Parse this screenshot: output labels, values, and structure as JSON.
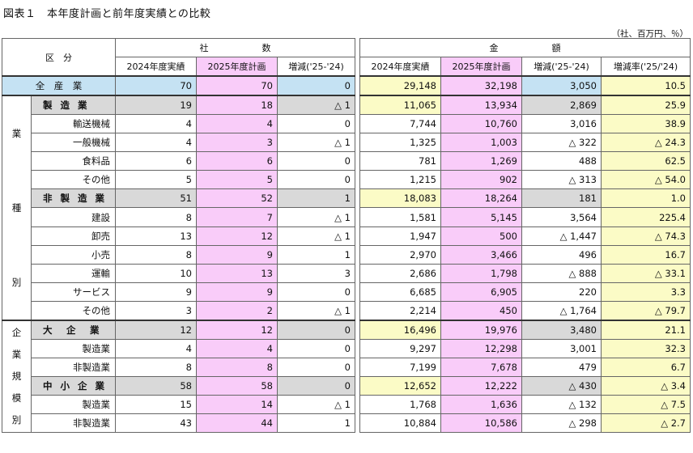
{
  "title": "図表１　本年度計画と前年度実績との比較",
  "unit": "（社、百万円、％）",
  "header": {
    "category": "区　分",
    "group_count": "社　　　　　　数",
    "group_amount": "金　　　　　　額",
    "count_cols": [
      "2024年度実績",
      "2025年度計画",
      "増減('25-'24)"
    ],
    "amount_cols": [
      "2024年度実績",
      "2025年度計画",
      "増減('25-'24)",
      "増減率('25/'24)"
    ]
  },
  "total": {
    "label": "全　産　業",
    "values": [
      "70",
      "70",
      "0",
      "29,148",
      "32,198",
      "3,050",
      "10.5"
    ]
  },
  "industry_section_label": [
    "業",
    "種",
    "別"
  ],
  "scale_section_label": [
    "企",
    "業",
    "規",
    "模",
    "別"
  ],
  "industry_rows": [
    {
      "label": "製 造 業",
      "bold": true,
      "values": [
        "19",
        "18",
        "△ 1",
        "11,065",
        "13,934",
        "2,869",
        "25.9"
      ]
    },
    {
      "label": "輸送機械",
      "bold": false,
      "values": [
        "4",
        "4",
        "0",
        "7,744",
        "10,760",
        "3,016",
        "38.9"
      ]
    },
    {
      "label": "一般機械",
      "bold": false,
      "values": [
        "4",
        "3",
        "△ 1",
        "1,325",
        "1,003",
        "△ 322",
        "△ 24.3"
      ]
    },
    {
      "label": "食料品",
      "bold": false,
      "values": [
        "6",
        "6",
        "0",
        "781",
        "1,269",
        "488",
        "62.5"
      ]
    },
    {
      "label": "その他",
      "bold": false,
      "values": [
        "5",
        "5",
        "0",
        "1,215",
        "902",
        "△ 313",
        "△ 54.0"
      ]
    },
    {
      "label": "非 製 造 業",
      "bold": true,
      "values": [
        "51",
        "52",
        "1",
        "18,083",
        "18,264",
        "181",
        "1.0"
      ]
    },
    {
      "label": "建設",
      "bold": false,
      "values": [
        "8",
        "7",
        "△ 1",
        "1,581",
        "5,145",
        "3,564",
        "225.4"
      ]
    },
    {
      "label": "卸売",
      "bold": false,
      "values": [
        "13",
        "12",
        "△ 1",
        "1,947",
        "500",
        "△ 1,447",
        "△ 74.3"
      ]
    },
    {
      "label": "小売",
      "bold": false,
      "values": [
        "8",
        "9",
        "1",
        "2,970",
        "3,466",
        "496",
        "16.7"
      ]
    },
    {
      "label": "運輸",
      "bold": false,
      "values": [
        "10",
        "13",
        "3",
        "2,686",
        "1,798",
        "△ 888",
        "△ 33.1"
      ]
    },
    {
      "label": "サービス",
      "bold": false,
      "values": [
        "9",
        "9",
        "0",
        "6,685",
        "6,905",
        "220",
        "3.3"
      ]
    },
    {
      "label": "その他",
      "bold": false,
      "values": [
        "3",
        "2",
        "△ 1",
        "2,214",
        "450",
        "△ 1,764",
        "△ 79.7"
      ]
    }
  ],
  "scale_rows": [
    {
      "label": "大　企　業",
      "bold": true,
      "values": [
        "12",
        "12",
        "0",
        "16,496",
        "19,976",
        "3,480",
        "21.1"
      ]
    },
    {
      "label": "製造業",
      "bold": false,
      "values": [
        "4",
        "4",
        "0",
        "9,297",
        "12,298",
        "3,001",
        "32.3"
      ]
    },
    {
      "label": "非製造業",
      "bold": false,
      "values": [
        "8",
        "8",
        "0",
        "7,199",
        "7,678",
        "479",
        "6.7"
      ]
    },
    {
      "label": "中 小 企 業",
      "bold": true,
      "values": [
        "58",
        "58",
        "0",
        "12,652",
        "12,222",
        "△ 430",
        "△ 3.4"
      ]
    },
    {
      "label": "製造業",
      "bold": false,
      "values": [
        "15",
        "14",
        "△ 1",
        "1,768",
        "1,636",
        "△ 132",
        "△ 7.5"
      ]
    },
    {
      "label": "非製造業",
      "bold": false,
      "values": [
        "43",
        "44",
        "1",
        "10,884",
        "10,586",
        "△ 298",
        "△ 2.7"
      ]
    }
  ],
  "colors": {
    "plan_column": "#f9ccf9",
    "highlight_yellow": "#fbfbc6",
    "total_blue": "#c5e2f3",
    "subtotal_grey": "#d9d9d9"
  }
}
